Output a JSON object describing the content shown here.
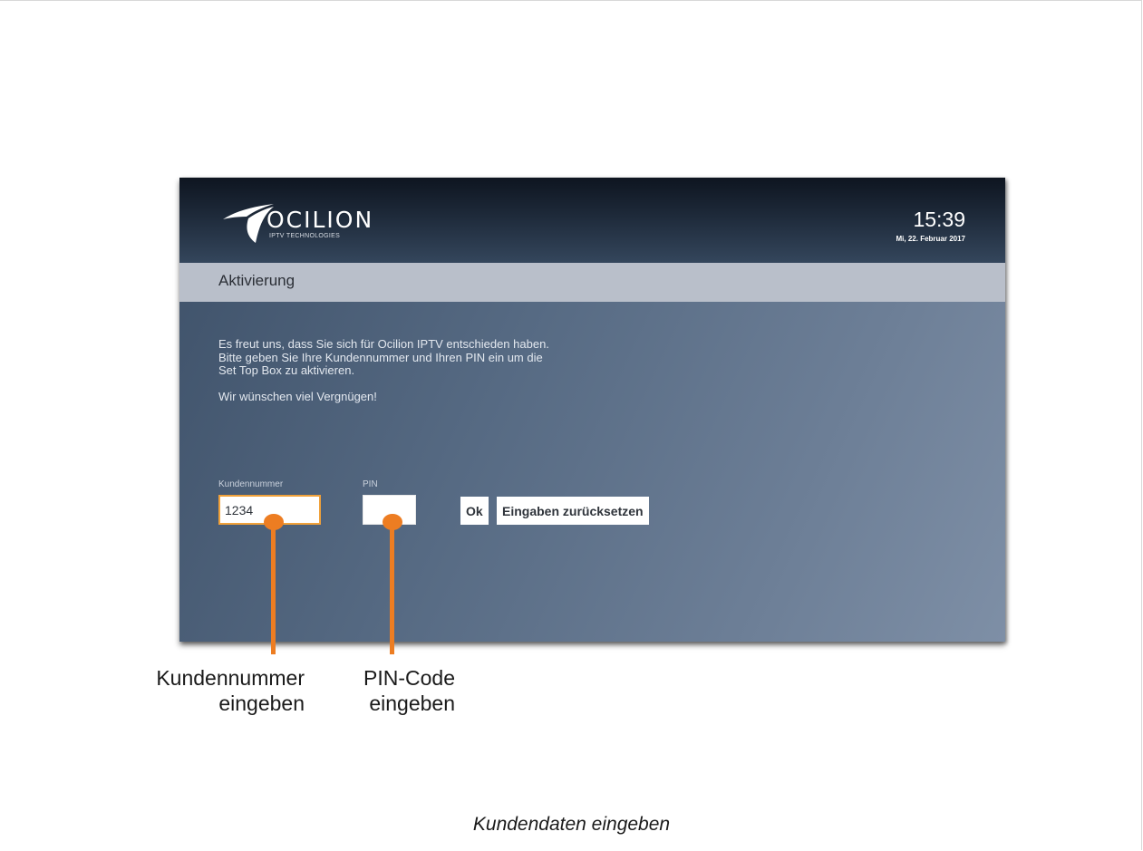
{
  "header": {
    "logo_text": "OCILION",
    "logo_subtitle": "IPTV TECHNOLOGIES",
    "time": "15:39",
    "date": "Mi, 22. Februar 2017"
  },
  "section": {
    "title": "Aktivierung"
  },
  "welcome": {
    "line1": "Es freut uns, dass Sie sich für Ocilion IPTV entschieden haben.",
    "line2": "Bitte geben Sie Ihre Kundennummer und Ihren PIN ein um die",
    "line3": "Set Top Box zu aktivieren.",
    "wish": "Wir wünschen viel Vergnügen!"
  },
  "form": {
    "customer_label": "Kundennummer",
    "customer_value": "1234",
    "pin_label": "PIN",
    "pin_value": "",
    "ok_label": "Ok",
    "reset_label": "Eingaben zurücksetzen"
  },
  "annotations": {
    "customer_line1": "Kundennummer",
    "customer_line2": "eingeben",
    "pin_line1": "PIN-Code",
    "pin_line2": "eingeben"
  },
  "caption": "Kundendaten eingeben",
  "colors": {
    "callout": "#ed7d22",
    "focus_border": "#f0a13a",
    "section_bar": "#b9bfca"
  }
}
